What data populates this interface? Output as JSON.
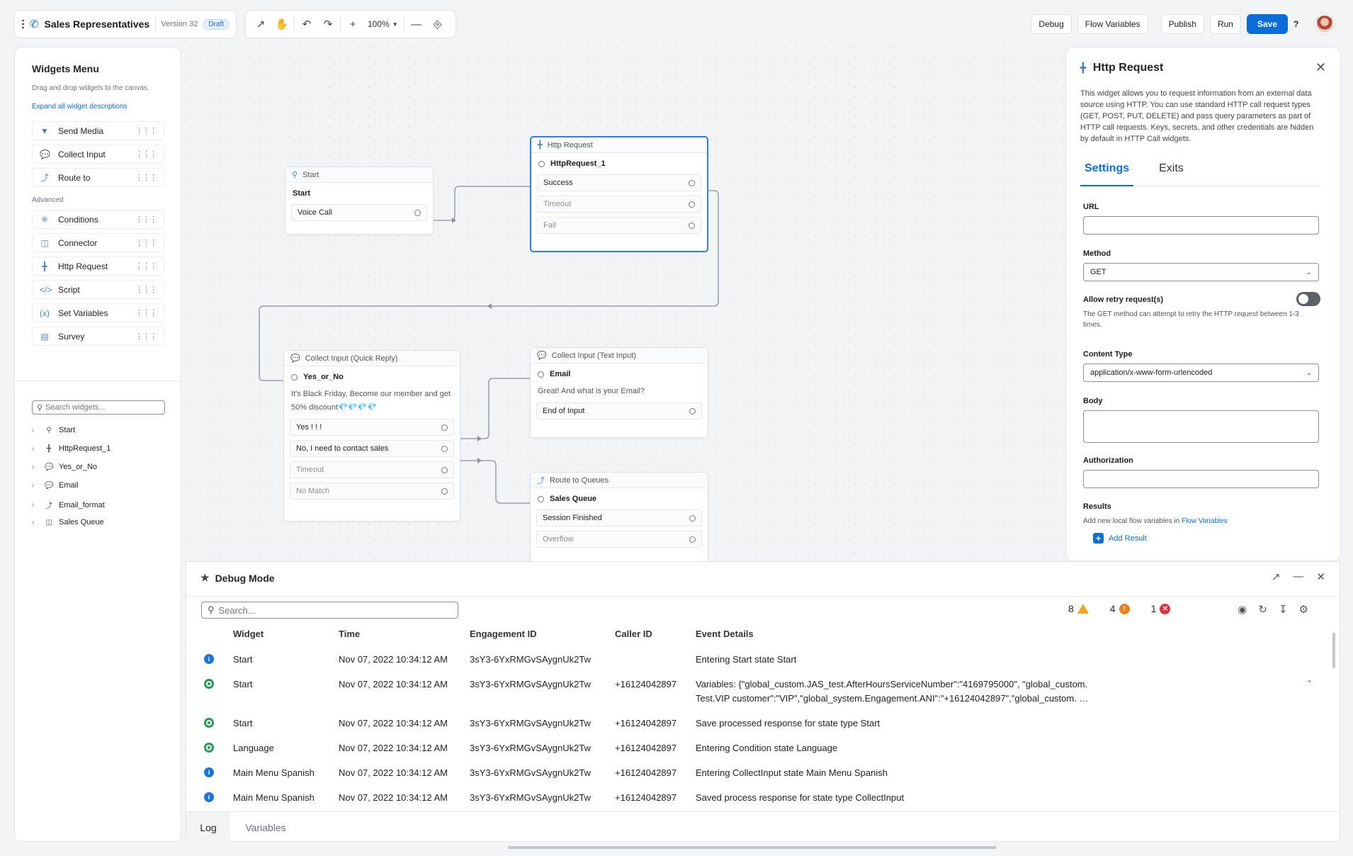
{
  "app": {
    "title": "Sales Representatives",
    "version": "Version 32",
    "status_badge": "Draft",
    "zoom": "100%"
  },
  "header_buttons": {
    "debug": "Debug",
    "flow_variables": "Flow Variables",
    "publish": "Publish",
    "run": "Run",
    "save": "Save",
    "help": "?"
  },
  "widgets_menu": {
    "title": "Widgets Menu",
    "subtitle": "Drag and drop widgets to the canvas.",
    "expand_link": "Expand all widget descriptions",
    "basic": [
      {
        "label": "Send Media",
        "icon": "send-media-icon"
      },
      {
        "label": "Collect Input",
        "icon": "chat-bubble-icon"
      },
      {
        "label": "Route to",
        "icon": "route-icon"
      }
    ],
    "advanced_label": "Advanced",
    "advanced": [
      {
        "label": "Conditions",
        "icon": "conditions-icon"
      },
      {
        "label": "Connector",
        "icon": "connector-icon"
      },
      {
        "label": "Http Request",
        "icon": "hierarchy-icon"
      },
      {
        "label": "Script",
        "icon": "code-icon"
      },
      {
        "label": "Set Variables",
        "icon": "variables-icon"
      },
      {
        "label": "Survey",
        "icon": "survey-icon"
      }
    ],
    "search_placeholder": "Search widgets...",
    "tree": [
      {
        "label": "Start"
      },
      {
        "label": "HttpRequest_1"
      },
      {
        "label": "Yes_or_No"
      },
      {
        "label": "Email"
      },
      {
        "label": "Email_format"
      },
      {
        "label": "Sales Queue"
      }
    ]
  },
  "canvas": {
    "start": {
      "header": "Start",
      "name": "Start",
      "exits": [
        "Voice Call"
      ]
    },
    "http": {
      "header": "Http Request",
      "name": "HttpRequest_1",
      "exits": [
        "Success",
        "Timeout",
        "Fail"
      ]
    },
    "quick_reply": {
      "header": "Collect Input (Quick Reply)",
      "name": "Yes_or_No",
      "description": "It's Black Friday, Become our member and get 50% discount💎💎💎💎",
      "exits": [
        "Yes ! ! !",
        "No, I need to contact sales",
        "Timeout",
        "No Match"
      ]
    },
    "text_input": {
      "header": "Collect Input (Text Input)",
      "name": "Email",
      "description": "Great! And what is your Email?",
      "exits": [
        "End of Input"
      ]
    },
    "route": {
      "header": "Route to Queues",
      "name": "Sales Queue",
      "exits": [
        "Session Finished",
        "Overflow"
      ]
    }
  },
  "properties": {
    "title": "Http Request",
    "description": "This widget allows you to request information from an external data source using HTTP. You can use standard HTTP call request types (GET, POST, PUT, DELETE) and pass query parameters as part of HTTP call requests. Keys, secrets, and other credentials are hidden by default in HTTP Call widgets.",
    "tabs": [
      "Settings",
      "Exits"
    ],
    "url_label": "URL",
    "url_value": "",
    "method_label": "Method",
    "method_value": "GET",
    "retry_label": "Allow retry request(s)",
    "retry_enabled": true,
    "retry_note": "The GET method can attempt to retry the HTTP request between 1-3 times.",
    "content_type_label": "Content Type",
    "content_type_value": "application/x-www-form-urlencoded",
    "body_label": "Body",
    "auth_label": "Authorization",
    "results_label": "Results",
    "results_note": "Add new local flow variables in",
    "results_link": "Flow Variables",
    "add_result": "Add Result"
  },
  "debug": {
    "title": "Debug Mode",
    "search_placeholder": "Search...",
    "counts": {
      "warnings": "8",
      "errors": "4",
      "critical": "1"
    },
    "columns": [
      "Widget",
      "Time",
      "Engagement ID",
      "Caller ID",
      "Event Details"
    ],
    "rows": [
      {
        "status": "info",
        "widget": "Start",
        "time": "Nov 07, 2022 10:34:12 AM",
        "engagement": "3sY3-6YxRMGvSAygnUk2Tw",
        "caller": "",
        "details": "Entering Start state Start",
        "details2": ""
      },
      {
        "status": "ok",
        "widget": "Start",
        "time": "Nov 07, 2022 10:34:12 AM",
        "engagement": "3sY3-6YxRMGvSAygnUk2Tw",
        "caller": "+16124042897",
        "details": "Variables: {\"global_custom.JAS_test.AfterHoursServiceNumber\":\"4169795000\", \"global_custom.",
        "details2": "Test.VIP customer\":\"VIP\",\"global_system.Engagement.ANI\":\"+16124042897\",\"global_custom. …"
      },
      {
        "status": "ok",
        "widget": "Start",
        "time": "Nov 07, 2022 10:34:12 AM",
        "engagement": "3sY3-6YxRMGvSAygnUk2Tw",
        "caller": "+16124042897",
        "details": "Save processed response for state type Start",
        "details2": ""
      },
      {
        "status": "ok",
        "widget": "Language",
        "time": "Nov 07, 2022 10:34:12 AM",
        "engagement": "3sY3-6YxRMGvSAygnUk2Tw",
        "caller": "+16124042897",
        "details": "Entering Condition state Language",
        "details2": ""
      },
      {
        "status": "info",
        "widget": "Main Menu Spanish",
        "time": "Nov 07, 2022 10:34:12 AM",
        "engagement": "3sY3-6YxRMGvSAygnUk2Tw",
        "caller": "+16124042897",
        "details": "Entering CollectInput state Main Menu Spanish",
        "details2": ""
      },
      {
        "status": "info",
        "widget": "Main Menu Spanish",
        "time": "Nov 07, 2022 10:34:12 AM",
        "engagement": "3sY3-6YxRMGvSAygnUk2Tw",
        "caller": "+16124042897",
        "details": "Saved process response for state type CollectInput",
        "details2": ""
      }
    ],
    "tabs": [
      "Log",
      "Variables"
    ]
  },
  "colors": {
    "accent": "#0b6ed8",
    "selected_border": "#2f7fe0",
    "info": "#1f74d6",
    "success": "#2c9b58",
    "warning": "#f5a623",
    "error": "#f07c1b",
    "critical": "#e0313a"
  }
}
